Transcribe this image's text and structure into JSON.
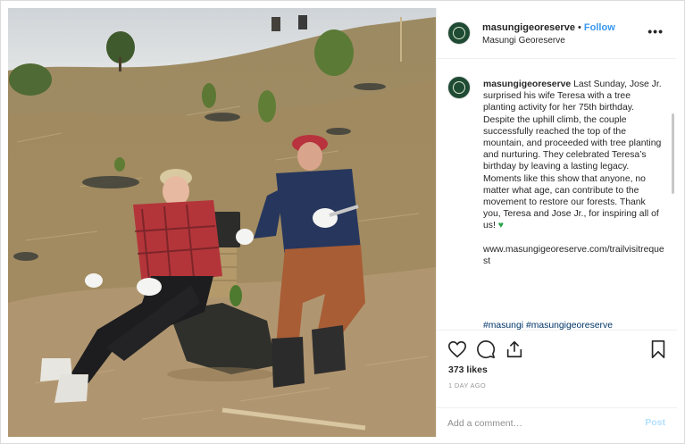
{
  "post": {
    "username": "masungigeoreserve",
    "dot": "•",
    "follow_label": "Follow",
    "location": "Masungi Georeserve",
    "more_label": "•••"
  },
  "caption": {
    "username": "masungigeoreserve",
    "text": "Last Sunday, Jose Jr. surprised his wife Teresa with a tree planting activity for her 75th birthday. Despite the uphill climb, the couple successfully reached the top of the mountain, and proceeded with tree planting and nurturing. They celebrated Teresa’s birthday by leaving a lasting legacy. Moments like this show that anyone, no matter what age, can contribute to the movement to restore our forests. Thank you, Teresa and Jose Jr., for inspiring all of us!",
    "emoji": "♥",
    "link": "www.masungigeoreserve.com/trailvisitrequest",
    "hashtags": "#masungi #masungigeoreserve"
  },
  "engagement": {
    "likes": "373 likes",
    "time": "1 DAY AGO"
  },
  "comment": {
    "placeholder": "Add a comment…",
    "post_label": "Post"
  },
  "icons": {
    "like": "heart-icon",
    "comment": "comment-bubble-icon",
    "share": "share-icon",
    "save": "bookmark-icon",
    "more": "more-options-icon",
    "avatar": "georeserve-logo"
  },
  "colors": {
    "follow": "#3897f0",
    "hashtag": "#003569",
    "avatar_bg": "#1f4a33",
    "emoji": "#2aa34a",
    "post_disabled": "#b2dffc"
  }
}
